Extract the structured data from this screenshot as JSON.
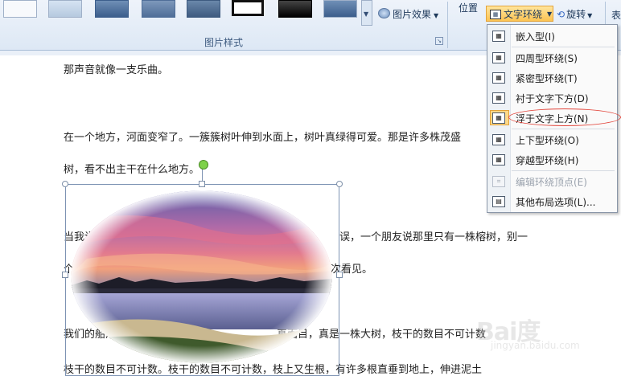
{
  "ribbon": {
    "picture_effects_label": "图片效果",
    "group_label": "图片样式",
    "position_label": "位置",
    "wrap_label": "文字环绕",
    "rotate_label": "旋转",
    "edge_label": "表"
  },
  "document": {
    "line1": "那声音就像一支乐曲。",
    "line2": "在一个地方，河面变窄了。一簇簇树叶伸到水面上，树叶真绿得可爱。那是许多株茂盛",
    "line3": "树，看不出主干在什么地方。",
    "line4_left": "当我说",
    "line4_right": "误，一个朋友说那里只有一株榕树，别一",
    "line5_left": "个",
    "line5_right": "一次看见。",
    "line6_left": "我们的船渐",
    "line6_right": "真面目，真是一株大树，枝干的数目不可计数",
    "line7": "枝干的数目不可计数。枝干的数目不可计数，枝上又生根，有许多根直垂到地上，伸进泥土"
  },
  "wrap_menu": {
    "items": [
      {
        "label": "嵌入型(I)",
        "enabled": true
      },
      {
        "label": "四周型环绕(S)",
        "enabled": true
      },
      {
        "label": "紧密型环绕(T)",
        "enabled": true
      },
      {
        "label": "衬于文字下方(D)",
        "enabled": true
      },
      {
        "label": "浮于文字上方(N)",
        "enabled": true,
        "active": true
      },
      {
        "label": "上下型环绕(O)",
        "enabled": true
      },
      {
        "label": "穿越型环绕(H)",
        "enabled": true
      },
      {
        "label": "编辑环绕顶点(E)",
        "enabled": false
      },
      {
        "label": "其他布局选项(L)...",
        "enabled": true
      }
    ]
  },
  "watermark": {
    "main": "Bai度",
    "sub": "jingyan.baidu.com"
  },
  "colors": {
    "selection_highlight": "#fcd98a",
    "annotation_circle": "#e2443a",
    "rotate_handle": "#7ed14a"
  }
}
